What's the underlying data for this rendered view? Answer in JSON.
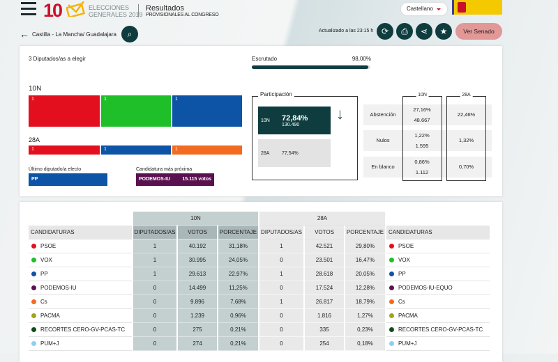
{
  "header": {
    "logo_number": "10",
    "logo_line1": "ELECCIONES",
    "logo_line2": "GENERALES 2019",
    "title": "Resultados",
    "subtitle": "PROVISIONALES AL CONGRESO",
    "language": "Castellano",
    "breadcrumb": "Castilla - La Mancha/ Guadalajara",
    "updated": "Actualizado a las 23:15 h",
    "senado_button": "Ver Senado"
  },
  "summary": {
    "seats_to_elect": "3 Diputados/as a elegir",
    "escrutado_label": "Escrutado",
    "escrutado_value": "98,00%",
    "escrutado_pct": 98.0,
    "bars_10n": {
      "label": "10N",
      "segments": [
        {
          "value": "1",
          "color": "#e30f1e"
        },
        {
          "value": "1",
          "color": "#1fbf2a"
        },
        {
          "value": "1",
          "color": "#0d53a6"
        }
      ]
    },
    "bars_28a": {
      "label": "28A",
      "segments": [
        {
          "value": "1",
          "color": "#e30f1e"
        },
        {
          "value": "1",
          "color": "#0d53a6"
        },
        {
          "value": "1",
          "color": "#f26b21"
        }
      ]
    },
    "last_elected_label": "Último diputado/a electo",
    "last_elected": "PP",
    "next_label": "Candidatura más próxima",
    "next_party": "PODEMOS-IU",
    "next_votes": "15.115 votos"
  },
  "participation": {
    "label": "Participación",
    "n10_label": "10N",
    "n10_pct": "72,84%",
    "n10_votes": "130.490",
    "a28_label": "28A",
    "a28_pct": "77,54%"
  },
  "stats": {
    "col_10n": "10N",
    "col_28a": "28A",
    "rows": [
      {
        "label": "Abstención",
        "n10_pct": "27,16%",
        "n10_num": "48.667",
        "a28": "22,46%"
      },
      {
        "label": "Nulos",
        "n10_pct": "1,22%",
        "n10_num": "1.595",
        "a28": "1,32%"
      },
      {
        "label": "En blanco",
        "n10_pct": "0,86%",
        "n10_num": "1.112",
        "a28": "0,70%"
      }
    ]
  },
  "table": {
    "group_10n": "10N",
    "group_28a": "28A",
    "col_cand": "CANDIDATURAS",
    "col_dip": "DIPUTADOS/AS",
    "col_votos": "VOTOS",
    "col_pct": "PORCENTAJE",
    "rows": [
      {
        "name": "PSOE",
        "color": "#e30f1e",
        "d10": "1",
        "v10": "40.192",
        "p10": "31,18%",
        "d28": "1",
        "v28": "42.521",
        "p28": "29,80%",
        "name28": "PSOE"
      },
      {
        "name": "VOX",
        "color": "#1fbf2a",
        "d10": "1",
        "v10": "30.995",
        "p10": "24,05%",
        "d28": "0",
        "v28": "23.501",
        "p28": "16,47%",
        "name28": "VOX"
      },
      {
        "name": "PP",
        "color": "#0d53a6",
        "d10": "1",
        "v10": "29.613",
        "p10": "22,97%",
        "d28": "1",
        "v28": "28.618",
        "p28": "20,05%",
        "name28": "PP"
      },
      {
        "name": "PODEMOS-IU",
        "color": "#5a1150",
        "d10": "0",
        "v10": "14.499",
        "p10": "11,25%",
        "d28": "0",
        "v28": "17.524",
        "p28": "12,28%",
        "name28": "PODEMOS-IU-EQUO"
      },
      {
        "name": "Cs",
        "color": "#f26b21",
        "d10": "0",
        "v10": "9.896",
        "p10": "7,68%",
        "d28": "1",
        "v28": "26.817",
        "p28": "18,79%",
        "name28": "Cs"
      },
      {
        "name": "PACMA",
        "color": "#a3a31a",
        "d10": "0",
        "v10": "1.239",
        "p10": "0,96%",
        "d28": "0",
        "v28": "1.816",
        "p28": "1,27%",
        "name28": "PACMA"
      },
      {
        "name": "RECORTES CERO-GV-PCAS-TC",
        "color": "#124d1b",
        "d10": "0",
        "v10": "275",
        "p10": "0,21%",
        "d28": "0",
        "v28": "335",
        "p28": "0,23%",
        "name28": "RECORTES CERO-GV-PCAS-TC"
      },
      {
        "name": "PUM+J",
        "color": "#8ecfee",
        "d10": "0",
        "v10": "274",
        "p10": "0,21%",
        "d28": "0",
        "v28": "254",
        "p28": "0,18%",
        "name28": "PUM+J"
      }
    ]
  }
}
